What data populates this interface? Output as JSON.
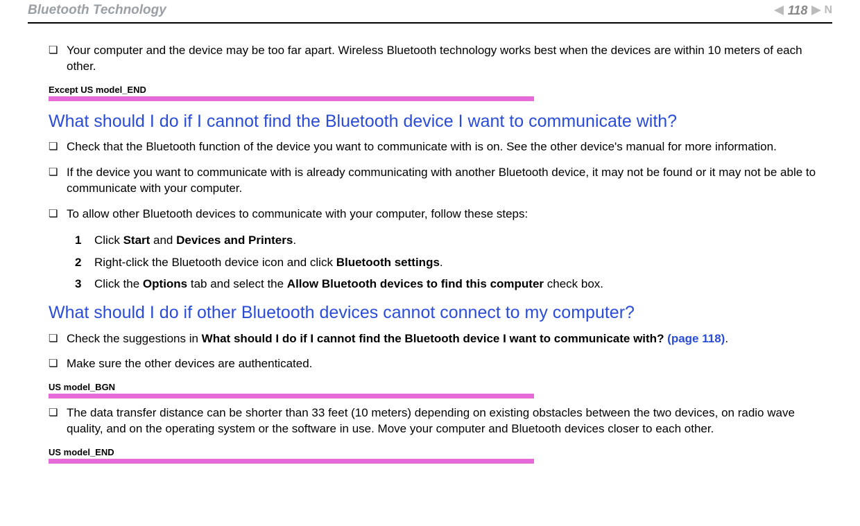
{
  "header": {
    "title": "Bluetooth Technology",
    "page_number": "118",
    "nav_n_glyph": "N"
  },
  "bullet_glyph": "❏",
  "intro_bullet": "Your computer and the device may be too far apart. Wireless Bluetooth technology works best when the devices are within 10 meters of each other.",
  "tag_except_us_end": "Except US model_END",
  "heading1": "What should I do if I cannot find the Bluetooth device I want to communicate with?",
  "h1_bullets": [
    "Check that the Bluetooth function of the device you want to communicate with is on. See the other device's manual for more information.",
    "If the device you want to communicate with is already communicating with another Bluetooth device, it may not be found or it may not be able to communicate with your computer.",
    "To allow other Bluetooth devices to communicate with your computer, follow these steps:"
  ],
  "steps": {
    "nums": [
      "1",
      "2",
      "3"
    ],
    "s1_pre": "Click ",
    "s1_b1": "Start",
    "s1_mid": " and ",
    "s1_b2": "Devices and Printers",
    "s1_post": ".",
    "s2_pre": "Right-click the Bluetooth device icon and click ",
    "s2_b1": "Bluetooth settings",
    "s2_post": ".",
    "s3_pre": "Click the ",
    "s3_b1": "Options",
    "s3_mid": " tab and select the ",
    "s3_b2": "Allow Bluetooth devices to find this computer",
    "s3_post": " check box."
  },
  "heading2": "What should I do if other Bluetooth devices cannot connect to my computer?",
  "h2_bullet1_pre": "Check the suggestions in ",
  "h2_bullet1_bold": "What should I do if I cannot find the Bluetooth device I want to communicate with? ",
  "h2_bullet1_link": "(page 118)",
  "h2_bullet1_post": ".",
  "h2_bullet2": "Make sure the other devices are authenticated.",
  "tag_us_bgn": "US model_BGN",
  "h2_bullet3": "The data transfer distance can be shorter than 33 feet (10 meters) depending on existing obstacles between the two devices, on radio wave quality, and on the operating system or the software in use. Move your computer and Bluetooth devices closer to each other.",
  "tag_us_end": "US model_END"
}
